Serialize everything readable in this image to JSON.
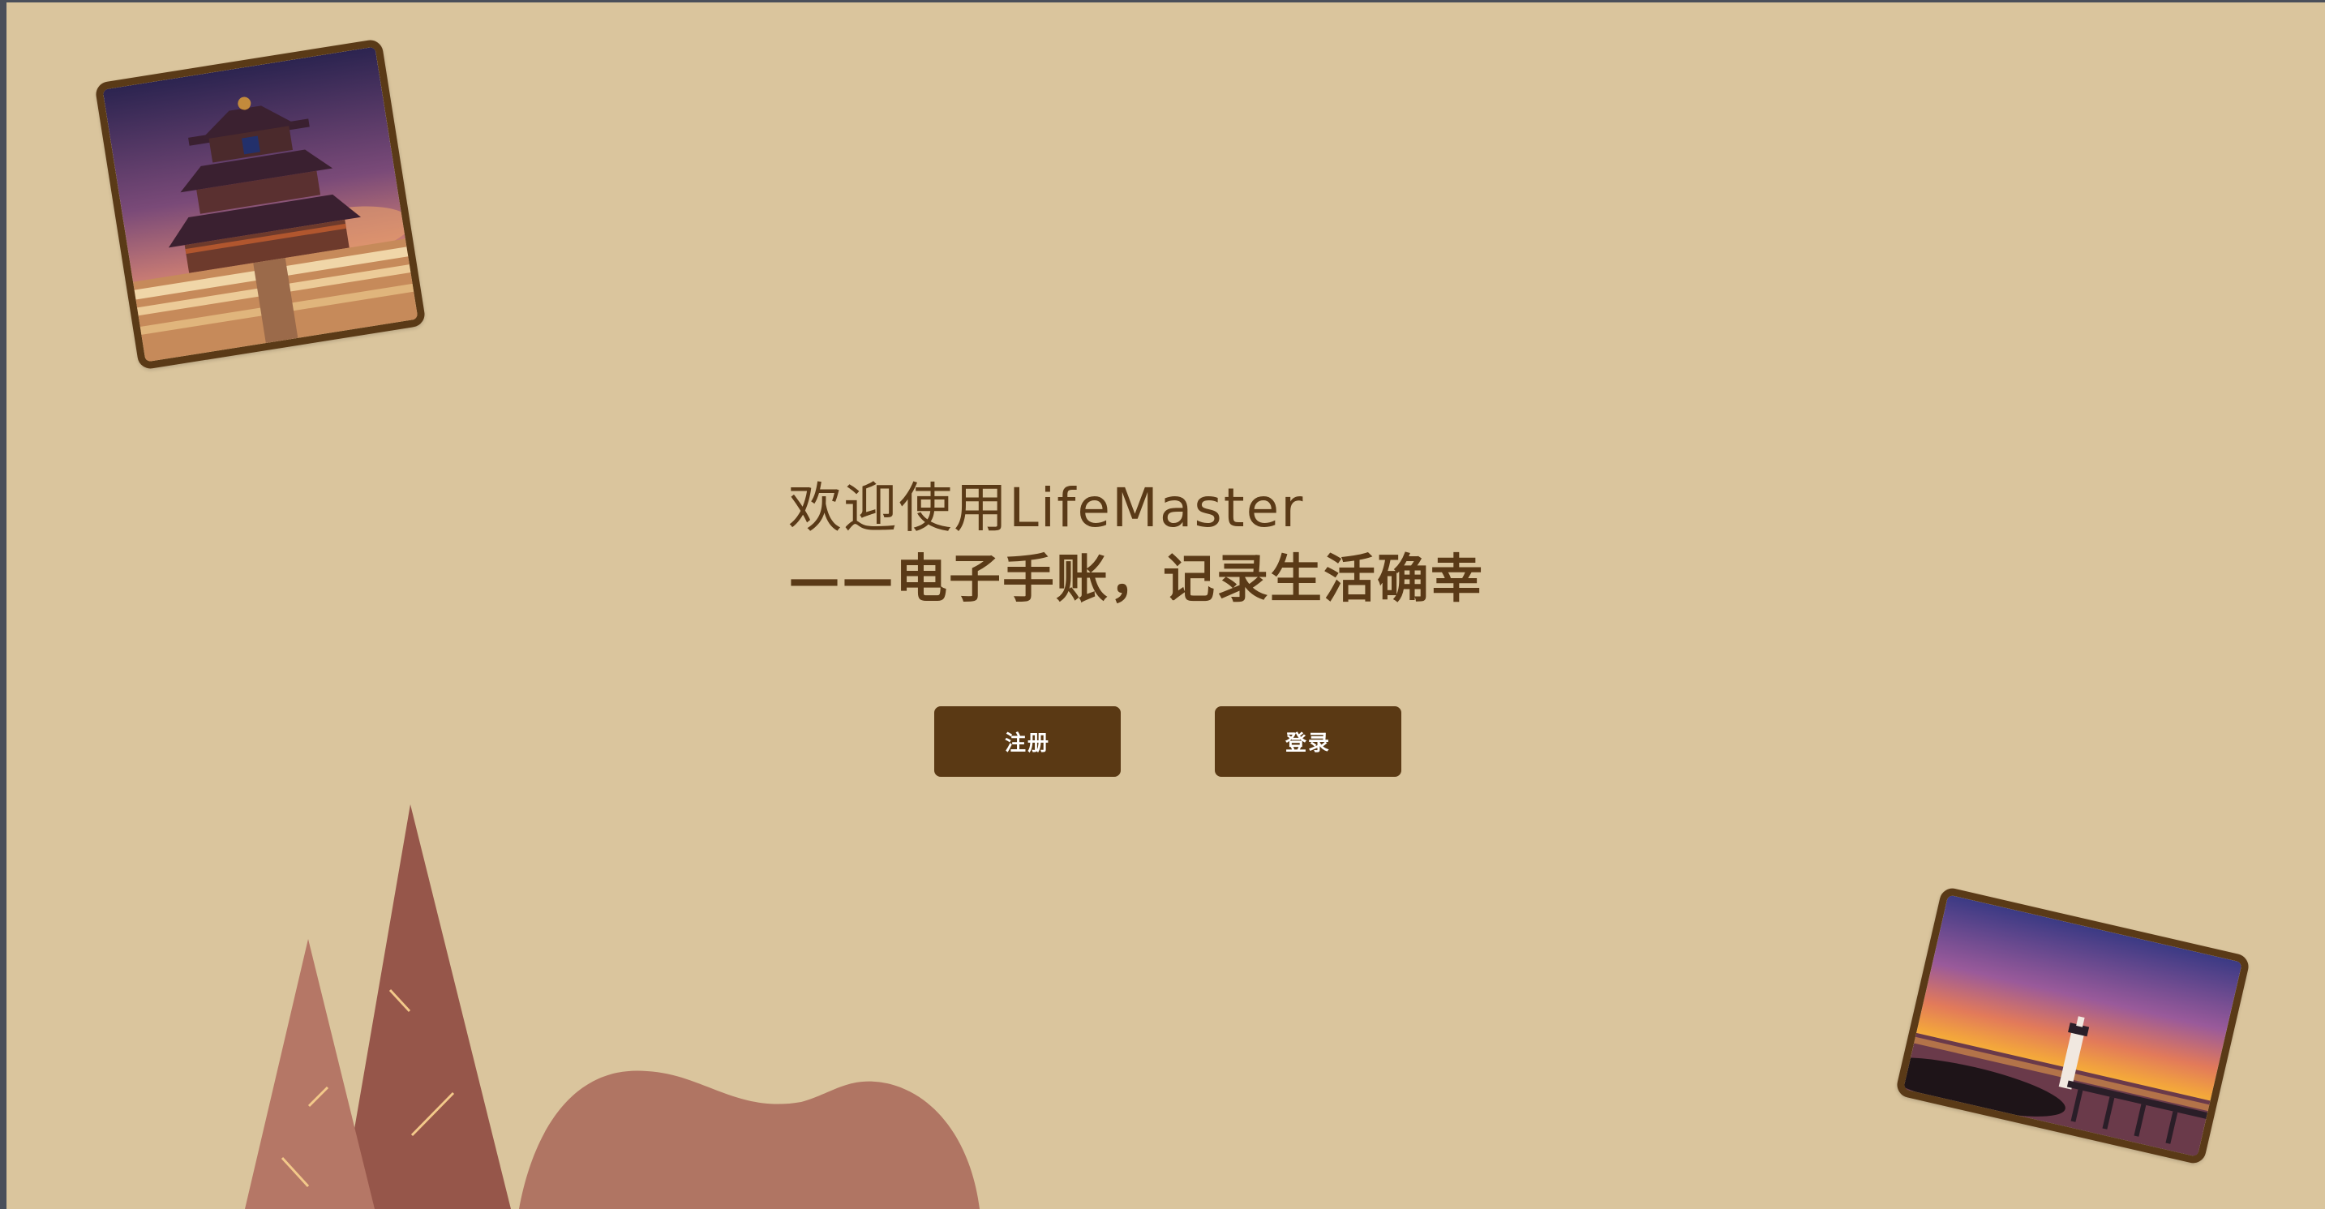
{
  "headline": {
    "line1": "欢迎使用LifeMaster",
    "line2": "——电子手账，记录生活确幸"
  },
  "buttons": {
    "register_label": "注册",
    "login_label": "登录"
  },
  "images": {
    "temple_icon": "temple-of-heaven-photo",
    "lighthouse_icon": "lighthouse-sunset-photo"
  },
  "colors": {
    "background": "#dac59d",
    "text": "#5a3a17",
    "button": "#5a3914",
    "frame": "#5a3a17",
    "tree_dark": "#96564a",
    "tree_light": "#b57766",
    "hill": "#b07563",
    "accent_line": "#f3c98a"
  }
}
